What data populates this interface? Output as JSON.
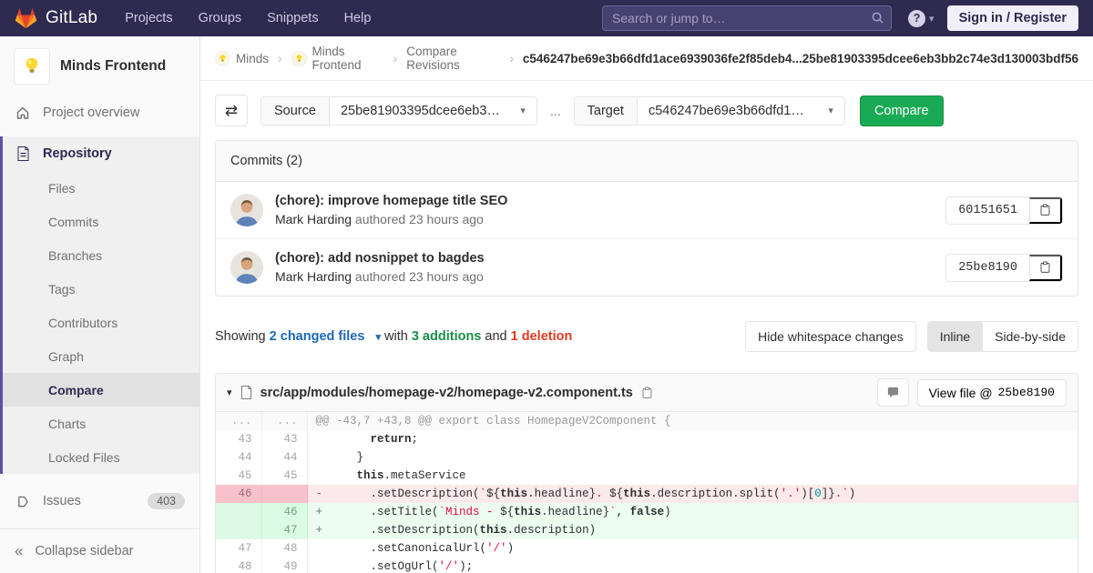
{
  "navbar": {
    "brand": "GitLab",
    "links": [
      "Projects",
      "Groups",
      "Snippets",
      "Help"
    ],
    "search_placeholder": "Search or jump to…",
    "help_icon": "question-mark-circle",
    "sign_in": "Sign in / Register"
  },
  "sidebar": {
    "project": "Minds Frontend",
    "project_avatar_icon": "lightbulb",
    "overview": "Project overview",
    "repository": "Repository",
    "repo_items": [
      "Files",
      "Commits",
      "Branches",
      "Tags",
      "Contributors",
      "Graph",
      "Compare",
      "Charts",
      "Locked Files"
    ],
    "active_repo_item": "Compare",
    "issues": "Issues",
    "issues_count": "403",
    "collapse": "Collapse sidebar"
  },
  "breadcrumb": {
    "items": [
      {
        "label": "Minds",
        "avatar": true
      },
      {
        "label": "Minds Frontend",
        "avatar": true
      },
      {
        "label": "Compare Revisions",
        "avatar": false
      }
    ],
    "current": "c546247be69e3b66dfd1ace6939036fe2f85deb4...25be81903395dcee6eb3bb2c74e3d130003bdf56"
  },
  "compare_form": {
    "swap_icon": "swap-arrows",
    "source_label": "Source",
    "source_value": "25be81903395dcee6eb3…",
    "separator": "...",
    "target_label": "Target",
    "target_value": "c546247be69e3b66dfd1…",
    "compare_button": "Compare"
  },
  "commits": {
    "header": "Commits (2)",
    "items": [
      {
        "title": "(chore): improve homepage title SEO",
        "author": "Mark Harding",
        "meta": "authored 23 hours ago",
        "sha": "60151651"
      },
      {
        "title": "(chore): add nosnippet to bagdes",
        "author": "Mark Harding",
        "meta": "authored 23 hours ago",
        "sha": "25be8190"
      }
    ]
  },
  "summary": {
    "showing": "Showing",
    "files_link": "2 changed files",
    "with_word": "with",
    "additions": "3 additions",
    "and_word": "and",
    "deletions": "1 deletion",
    "hide_whitespace": "Hide whitespace changes",
    "inline": "Inline",
    "side_by_side": "Side-by-side"
  },
  "diff": {
    "file_path": "src/app/modules/homepage-v2/homepage-v2.component.ts",
    "view_file": "View file @",
    "view_sha": "25be8190",
    "rows": [
      {
        "type": "hunk",
        "old": "...",
        "new": "...",
        "marker": "",
        "segs": [
          [
            "@@ -43,7 +43,8 @@ export class HomepageV2Component {",
            ""
          ]
        ]
      },
      {
        "type": "ctx",
        "old": "43",
        "new": "43",
        "marker": " ",
        "segs": [
          [
            "      ",
            ""
          ],
          [
            "return",
            "k"
          ],
          [
            ";",
            ""
          ]
        ]
      },
      {
        "type": "ctx",
        "old": "44",
        "new": "44",
        "marker": " ",
        "segs": [
          [
            "    }",
            ""
          ]
        ]
      },
      {
        "type": "ctx",
        "old": "45",
        "new": "45",
        "marker": " ",
        "segs": [
          [
            "    ",
            ""
          ],
          [
            "this",
            "k"
          ],
          [
            ".metaService",
            ""
          ]
        ]
      },
      {
        "type": "del",
        "old": "46",
        "new": "",
        "marker": "-",
        "segs": [
          [
            "      .setDescription(",
            ""
          ],
          [
            "`",
            "s"
          ],
          [
            "${",
            ""
          ],
          [
            "this",
            "k"
          ],
          [
            ".headline}",
            ""
          ],
          [
            ". ",
            "s"
          ],
          [
            "${",
            ""
          ],
          [
            "this",
            "k"
          ],
          [
            ".description.split(",
            ""
          ],
          [
            "'.'",
            "s"
          ],
          [
            ")[",
            ""
          ],
          [
            "0",
            "mi"
          ],
          [
            "]}",
            ""
          ],
          [
            ".`",
            "s"
          ],
          [
            ")",
            ""
          ]
        ]
      },
      {
        "type": "add",
        "old": "",
        "new": "46",
        "marker": "+",
        "segs": [
          [
            "      .setTitle(",
            ""
          ],
          [
            "`Minds - ",
            "s"
          ],
          [
            "${",
            ""
          ],
          [
            "this",
            "k"
          ],
          [
            ".headline}",
            ""
          ],
          [
            "`",
            "s"
          ],
          [
            ", ",
            ""
          ],
          [
            "false",
            "k"
          ],
          [
            ")",
            ""
          ]
        ]
      },
      {
        "type": "add",
        "old": "",
        "new": "47",
        "marker": "+",
        "segs": [
          [
            "      .setDescription(",
            ""
          ],
          [
            "this",
            "k"
          ],
          [
            ".description)",
            ""
          ]
        ]
      },
      {
        "type": "ctx",
        "old": "47",
        "new": "48",
        "marker": " ",
        "segs": [
          [
            "      .setCanonicalUrl(",
            ""
          ],
          [
            "'/'",
            "s"
          ],
          [
            ")",
            ""
          ]
        ]
      },
      {
        "type": "ctx",
        "old": "48",
        "new": "49",
        "marker": " ",
        "segs": [
          [
            "      .setOgUrl(",
            ""
          ],
          [
            "'/'",
            "s"
          ],
          [
            ");",
            ""
          ]
        ]
      }
    ]
  },
  "colors": {
    "navbar_bg": "#2f2a4f",
    "accent_indigo": "#5a52a3",
    "link_blue": "#1b69b6",
    "addition_green": "#168f48",
    "deletion_red": "#db3b21",
    "compare_button_green": "#1aaa55",
    "string_red": "#d14",
    "number_teal": "#099"
  }
}
